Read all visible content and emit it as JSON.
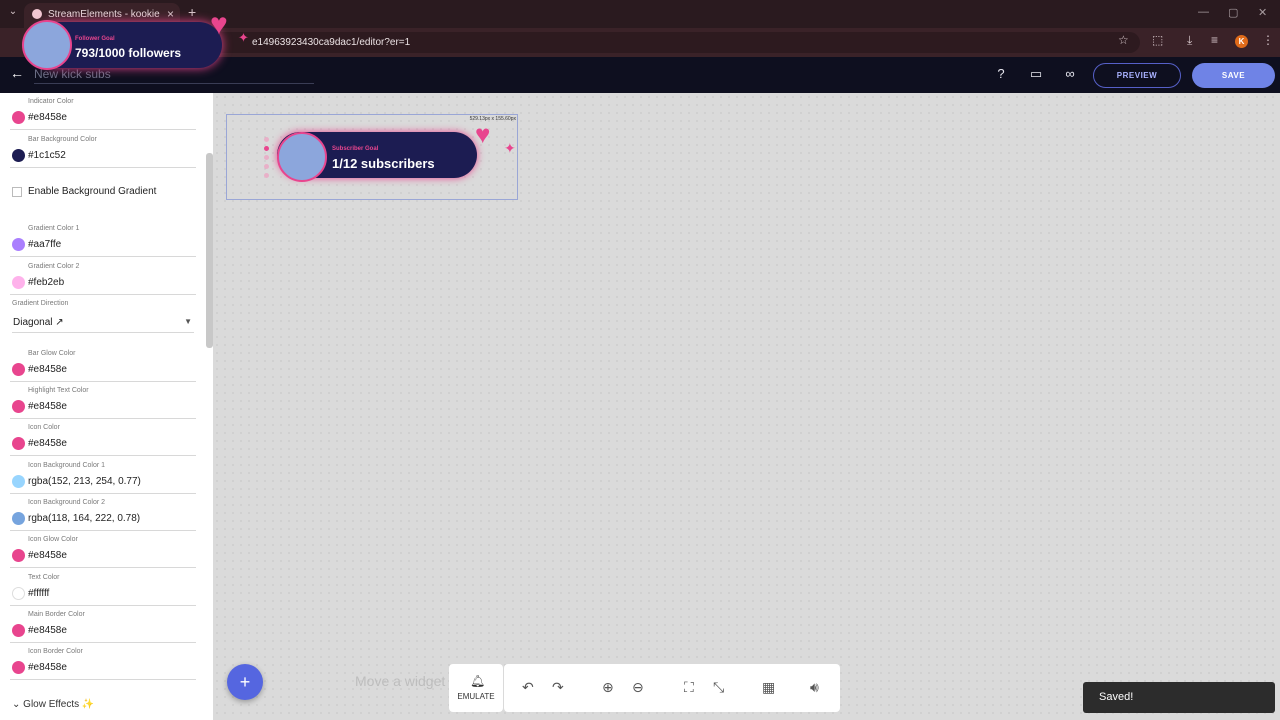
{
  "browser": {
    "tab_title": "StreamElements - kookie",
    "url": "e14963923430ca9dac1/editor?er=1",
    "profile_initial": "K"
  },
  "header": {
    "widget_name": "New kick subs",
    "preview_label": "PREVIEW",
    "save_label": "SAVE"
  },
  "sidebar": {
    "fields_top": [
      {
        "label": "Indicator Color",
        "value": "#e8458e",
        "color": "#e8458e"
      },
      {
        "label": "Bar Background Color",
        "value": "#1c1c52",
        "color": "#1c1c52"
      }
    ],
    "bg_gradient_label": "Enable Background Gradient",
    "fields_gradient": [
      {
        "label": "Gradient Color 1",
        "value": "#aa7ffe",
        "color": "#aa7ffe"
      },
      {
        "label": "Gradient Color 2",
        "value": "#feb2eb",
        "color": "#feb2eb"
      }
    ],
    "direction_label": "Gradient Direction",
    "direction_value": "Diagonal ↗",
    "fields_bottom": [
      {
        "label": "Bar Glow Color",
        "value": "#e8458e",
        "color": "#e8458e"
      },
      {
        "label": "Highlight Text Color",
        "value": "#e8458e",
        "color": "#e8458e"
      },
      {
        "label": "Icon Color",
        "value": "#e8458e",
        "color": "#e8458e"
      },
      {
        "label": "Icon Background Color 1",
        "value": "rgba(152, 213, 254, 0.77)",
        "color": "#98d5fe"
      },
      {
        "label": "Icon Background Color 2",
        "value": "rgba(118, 164, 222, 0.78)",
        "color": "#76a4de"
      },
      {
        "label": "Icon Glow Color",
        "value": "#e8458e",
        "color": "#e8458e"
      },
      {
        "label": "Text Color",
        "value": "#ffffff",
        "color": "#ffffff"
      },
      {
        "label": "Main Border Color",
        "value": "#e8458e",
        "color": "#e8458e"
      },
      {
        "label": "Icon Border Color",
        "value": "#e8458e",
        "color": "#e8458e"
      }
    ],
    "glow_section_label": "Glow Effects ✨"
  },
  "canvas": {
    "widget_dims": "529.13px x 155.60px",
    "sub_goal_label": "Subscriber Goal",
    "sub_goal_text": "1/12 subscribers",
    "hint": "Move a widget"
  },
  "toolbar": {
    "emulate_label": "EMULATE"
  },
  "toast": "Saved!",
  "overlay": {
    "label": "Follower Goal",
    "text": "793/1000 followers"
  }
}
